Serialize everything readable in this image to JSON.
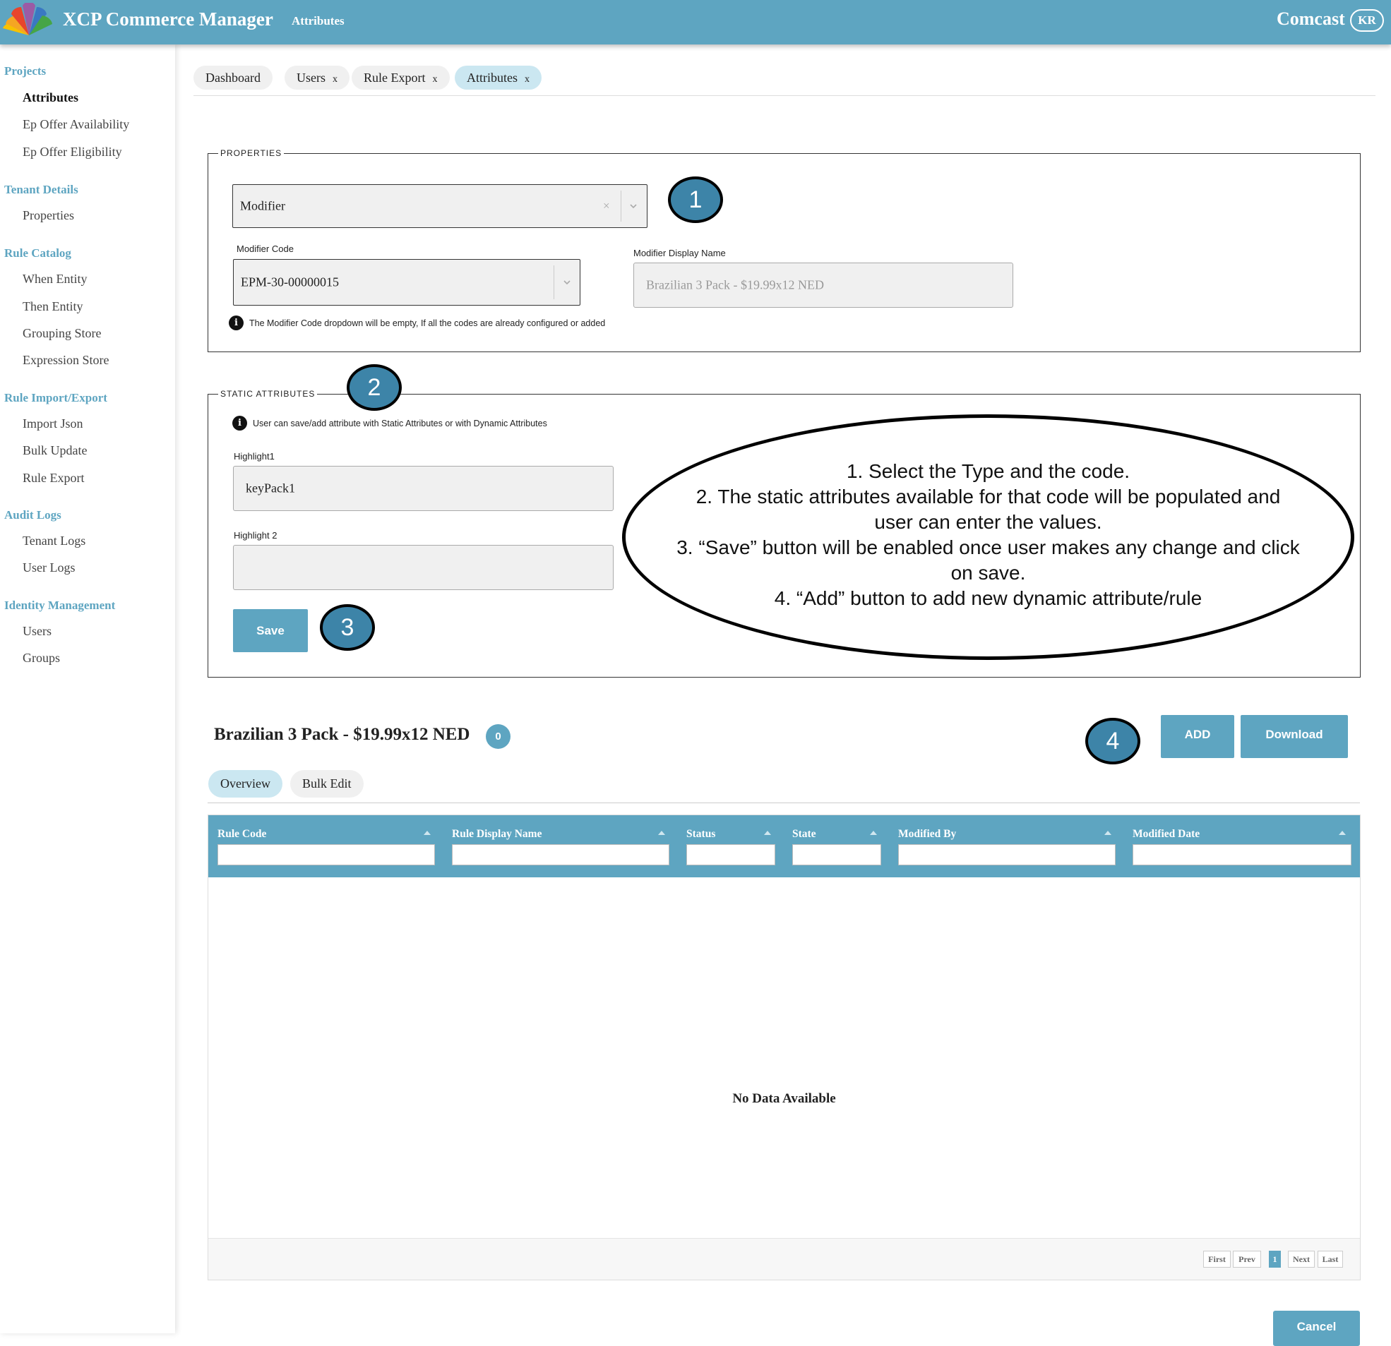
{
  "header": {
    "app_title": "XCP Commerce Manager",
    "breadcrumb": "Attributes",
    "brand": "Comcast",
    "user_initials": "KR",
    "bg_color": "#5ea5c1"
  },
  "sidebar": {
    "sections": [
      {
        "title": "Projects",
        "items": [
          "Attributes",
          "Ep Offer Availability",
          "Ep Offer Eligibility"
        ]
      },
      {
        "title": "Tenant Details",
        "items": [
          "Properties"
        ]
      },
      {
        "title": "Rule Catalog",
        "items": [
          "When Entity",
          "Then Entity",
          "Grouping Store",
          "Expression Store"
        ]
      },
      {
        "title": "Rule Import/Export",
        "items": [
          "Import Json",
          "Bulk Update",
          "Rule Export"
        ]
      },
      {
        "title": "Audit Logs",
        "items": [
          "Tenant Logs",
          "User Logs"
        ]
      },
      {
        "title": "Identity Management",
        "items": [
          "Users",
          "Groups"
        ]
      }
    ],
    "active_item": "Attributes"
  },
  "tabs": [
    {
      "label": "Dashboard",
      "closable": false
    },
    {
      "label": "Users",
      "closable": true
    },
    {
      "label": "Rule Export",
      "closable": true
    },
    {
      "label": "Attributes",
      "closable": true,
      "active": true
    }
  ],
  "tab_close_glyph": "x",
  "properties": {
    "legend": "PROPERTIES",
    "type_value": "Modifier",
    "clear_glyph": "×",
    "modifier_code_label": "Modifier Code",
    "modifier_code_value": "EPM-30-00000015",
    "display_name_label": "Modifier Display Name",
    "display_name_value": "Brazilian 3 Pack - $19.99x12 NED",
    "info_text": "The Modifier Code dropdown will be empty, If all the codes are already configured or added"
  },
  "static_attributes": {
    "legend": "STATIC ATTRIBUTES",
    "info_text": "User can save/add attribute with Static Attributes or with Dynamic Attributes",
    "highlight1_label": "Highlight1",
    "highlight1_value": "keyPack1",
    "highlight2_label": "Highlight 2",
    "highlight2_value": "",
    "save_label": "Save"
  },
  "markers": [
    "1",
    "2",
    "3",
    "4"
  ],
  "annotation_lines": [
    "1. Select the Type and the code.",
    "2. The static attributes available for that code will be populated and",
    "user can enter the values.",
    "3. “Save” button will be enabled once user makes any change and click",
    "on save.",
    "4. “Add” button to add new dynamic attribute/rule"
  ],
  "rules": {
    "title": "Brazilian 3 Pack - $19.99x12 NED",
    "count": "0",
    "add_label": "ADD",
    "download_label": "Download",
    "subtabs": [
      "Overview",
      "Bulk Edit"
    ],
    "columns": [
      "Rule Code",
      "Rule Display Name",
      "Status",
      "State",
      "Modified By",
      "Modified Date"
    ],
    "empty_text": "No Data Available",
    "pager": {
      "first": "First",
      "prev": "Prev",
      "current": "1",
      "next": "Next",
      "last": "Last"
    }
  },
  "cancel_label": "Cancel"
}
